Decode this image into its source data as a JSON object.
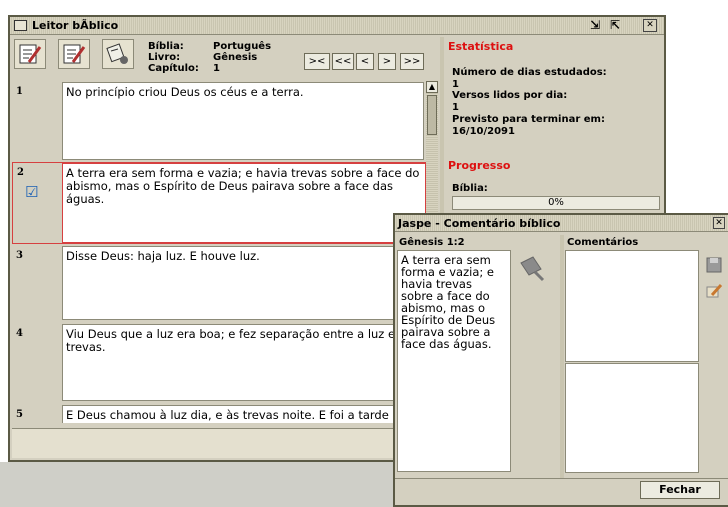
{
  "main_window": {
    "title": "Leitor bÃ­blico",
    "labels": {
      "bible": "Bíblia:",
      "book": "Livro:",
      "chapter": "Capítulo:"
    },
    "values": {
      "bible": "Português",
      "book": "Gênesis",
      "chapter": "1"
    },
    "nav": {
      "first": "><",
      "prev_chapter": "<<",
      "prev": "<",
      "next": ">",
      "next_chapter": ">>"
    },
    "verses": [
      {
        "num": "1",
        "text": "No princípio criou Deus os céus e a terra.",
        "checked": false
      },
      {
        "num": "2",
        "text": "A terra era sem forma e vazia; e havia trevas sobre a face do abismo, mas o Espírito de Deus pairava sobre a face das águas.",
        "checked": true
      },
      {
        "num": "3",
        "text": "Disse Deus: haja luz. E houve luz.",
        "checked": false
      },
      {
        "num": "4",
        "text": "Viu Deus que a luz era boa; e fez separação entre a luz e as trevas.",
        "checked": false
      },
      {
        "num": "5",
        "text": "E Deus chamou à luz dia, e às trevas noite. E foi a tarde e a manhã, o dia primeiro.",
        "checked": false
      }
    ],
    "checkmark": "☑"
  },
  "stats": {
    "title": "Estatística",
    "days_label": "Número de dias estudados:",
    "days_value": "1",
    "verses_label": "Versos lidos por dia:",
    "verses_value": "1",
    "forecast_label": "Previsto para terminar em:",
    "forecast_value": "16/10/2091",
    "progress_title": "Progresso",
    "bible_label": "Bíblia:",
    "progress_text": "0%",
    "progress_fraction": 0
  },
  "comment_window": {
    "title": "Jaspe - Comentário bíblico",
    "reference": "Gênesis 1:2",
    "verse_text": "A terra era sem forma e vazia; e havia trevas sobre a face do abismo, mas o Espírito de Deus pairava sobre a face das águas.",
    "comments_label": "Comentários",
    "close_button": "Fechar"
  },
  "colors": {
    "accent_red": "#dd1010",
    "window_bg": "#d4d0c0"
  },
  "icons": [
    "edit-notes-icon",
    "edit-notes-icon-2",
    "settings-pen-icon",
    "pin-icon",
    "save-icon",
    "edit-comment-icon"
  ]
}
